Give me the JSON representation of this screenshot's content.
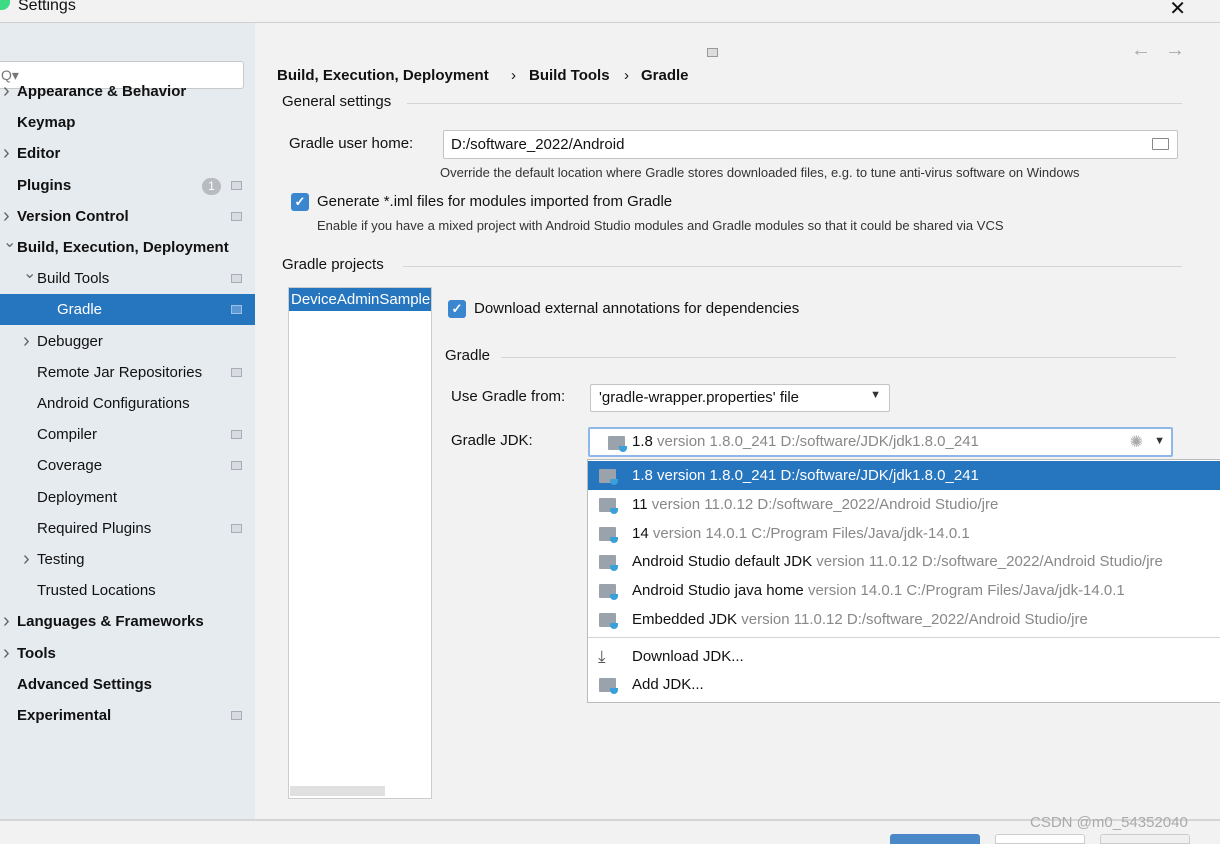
{
  "window": {
    "title": "Settings"
  },
  "search": {
    "placeholder": "Q▾"
  },
  "sidebar": {
    "items": [
      {
        "label": "Appearance & Behavior",
        "level": 0,
        "chevron": true,
        "bold": true
      },
      {
        "label": "Keymap",
        "level": 0,
        "bold": true
      },
      {
        "label": "Editor",
        "level": 0,
        "chevron": true,
        "bold": true
      },
      {
        "label": "Plugins",
        "level": 0,
        "bold": true,
        "badge": "1",
        "mini": true
      },
      {
        "label": "Version Control",
        "level": 0,
        "chevron": true,
        "bold": true,
        "mini": true
      },
      {
        "label": "Build, Execution, Deployment",
        "level": 0,
        "chevron": true,
        "expanded": true,
        "bold": true
      },
      {
        "label": "Build Tools",
        "level": 1,
        "chevron": true,
        "expanded": true,
        "mini": true
      },
      {
        "label": "Gradle",
        "level": 2,
        "selected": true,
        "mini": true
      },
      {
        "label": "Debugger",
        "level": 1,
        "chevron": true
      },
      {
        "label": "Remote Jar Repositories",
        "level": 1,
        "mini": true
      },
      {
        "label": "Android Configurations",
        "level": 1
      },
      {
        "label": "Compiler",
        "level": 1,
        "mini": true
      },
      {
        "label": "Coverage",
        "level": 1,
        "mini": true
      },
      {
        "label": "Deployment",
        "level": 1
      },
      {
        "label": "Required Plugins",
        "level": 1,
        "mini": true
      },
      {
        "label": "Testing",
        "level": 1,
        "chevron": true
      },
      {
        "label": "Trusted Locations",
        "level": 1
      },
      {
        "label": "Languages & Frameworks",
        "level": 0,
        "chevron": true,
        "bold": true
      },
      {
        "label": "Tools",
        "level": 0,
        "chevron": true,
        "bold": true
      },
      {
        "label": "Advanced Settings",
        "level": 0,
        "bold": true
      },
      {
        "label": "Experimental",
        "level": 0,
        "bold": true,
        "mini": true
      }
    ]
  },
  "breadcrumb": [
    "Build, Execution, Deployment",
    "Build Tools",
    "Gradle"
  ],
  "general": {
    "title": "General settings",
    "home_label": "Gradle user home:",
    "home_value": "D:/software_2022/Android",
    "home_hint": "Override the default location where Gradle stores downloaded files, e.g. to tune anti-virus software on Windows",
    "iml_label": "Generate *.iml files for modules imported from Gradle",
    "iml_checked": true,
    "iml_hint": "Enable if you have a mixed project with Android Studio modules and Gradle modules so that it could be shared via VCS"
  },
  "projects": {
    "title": "Gradle projects",
    "list": [
      "DeviceAdminSample"
    ],
    "annotations_label": "Download external annotations for dependencies",
    "annotations_checked": true,
    "gradle_title": "Gradle",
    "use_from_label": "Use Gradle from:",
    "use_from_value": "'gradle-wrapper.properties' file",
    "jdk_label": "Gradle JDK:",
    "jdk_name": "1.8",
    "jdk_detail": "version 1.8.0_241 D:/software/JDK/jdk1.8.0_241"
  },
  "jdk_options": [
    {
      "name": "1.8",
      "detail": "version 1.8.0_241 D:/software/JDK/jdk1.8.0_241",
      "selected": true
    },
    {
      "name": "11",
      "detail": "version 11.0.12 D:/software_2022/Android Studio/jre"
    },
    {
      "name": "14",
      "detail": "version 14.0.1 C:/Program Files/Java/jdk-14.0.1"
    },
    {
      "name": "Android Studio default JDK",
      "detail": "version 11.0.12 D:/software_2022/Android Studio/jre"
    },
    {
      "name": "Android Studio java home",
      "detail": "version 14.0.1 C:/Program Files/Java/jdk-14.0.1"
    },
    {
      "name": "Embedded JDK",
      "detail": "version 11.0.12 D:/software_2022/Android Studio/jre"
    }
  ],
  "jdk_actions": [
    {
      "label": "Download JDK...",
      "icon": "download-icon"
    },
    {
      "label": "Add JDK...",
      "icon": "folder-icon"
    }
  ],
  "watermark": "CSDN @m0_54352040",
  "colors": {
    "selection": "#2675bf",
    "sidebar": "#e6ebf0"
  }
}
